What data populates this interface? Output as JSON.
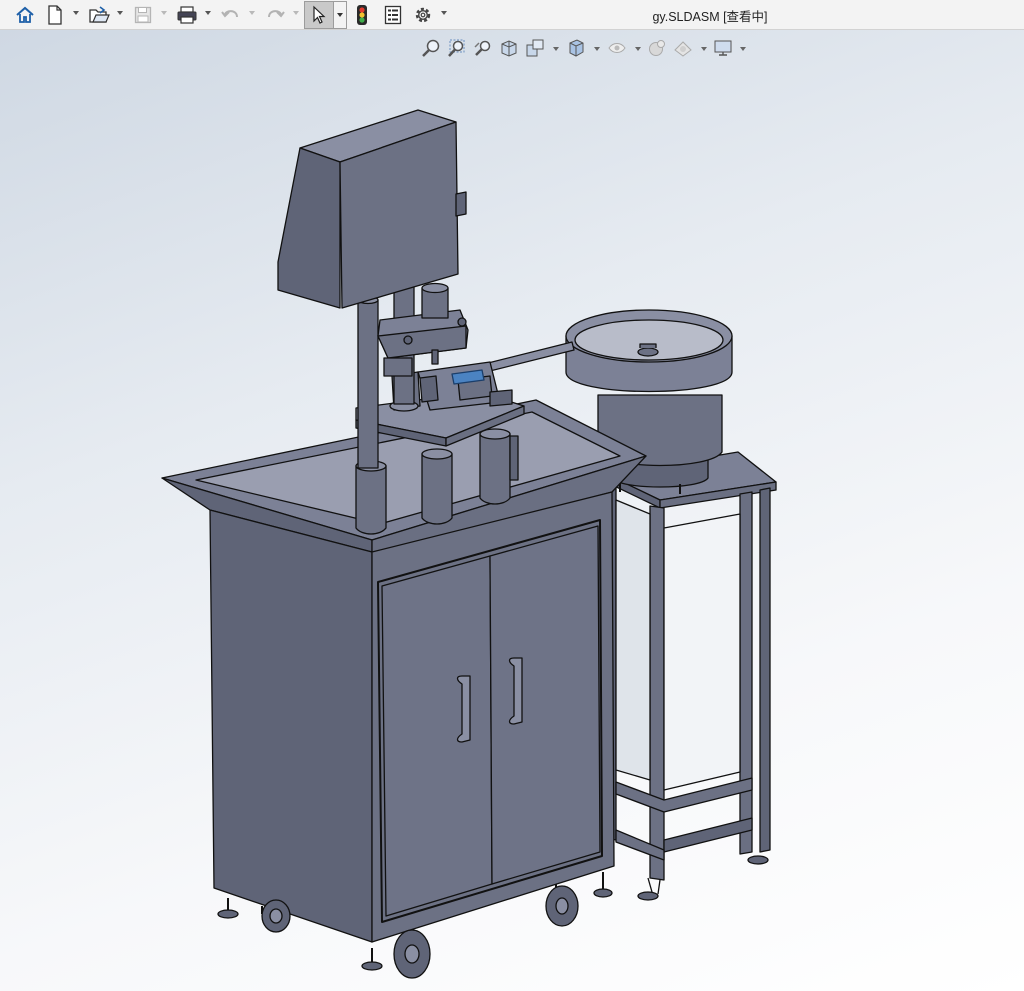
{
  "window": {
    "title": "gy.SLDASM [查看中]"
  },
  "toolbar": {
    "buttons": [
      {
        "name": "home",
        "icon": "home-icon"
      },
      {
        "name": "new",
        "icon": "new-document-icon"
      },
      {
        "name": "open",
        "icon": "open-folder-icon"
      },
      {
        "name": "save",
        "icon": "save-icon",
        "disabled": true
      },
      {
        "name": "print",
        "icon": "print-icon"
      },
      {
        "name": "undo",
        "icon": "undo-icon",
        "disabled": true
      },
      {
        "name": "redo",
        "icon": "redo-icon",
        "disabled": true
      },
      {
        "name": "select",
        "icon": "select-arrow-icon",
        "active": true
      },
      {
        "name": "rebuild",
        "icon": "traffic-light-icon"
      },
      {
        "name": "file-properties",
        "icon": "file-properties-icon"
      },
      {
        "name": "options",
        "icon": "gear-icon"
      }
    ]
  },
  "heads_up_toolbar": {
    "buttons": [
      {
        "name": "zoom-to-fit",
        "icon": "zoom-to-fit-icon"
      },
      {
        "name": "zoom-to-area",
        "icon": "zoom-to-area-icon"
      },
      {
        "name": "previous-view",
        "icon": "previous-view-icon"
      },
      {
        "name": "section-view",
        "icon": "section-view-icon"
      },
      {
        "name": "dynamic-annotation-views",
        "icon": "annotation-view-icon"
      },
      {
        "name": "view-orientation",
        "icon": "view-cube-icon"
      },
      {
        "name": "display-style",
        "icon": "display-style-icon"
      },
      {
        "name": "hide-show-items",
        "icon": "eye-icon"
      },
      {
        "name": "edit-appearance",
        "icon": "appearance-sphere-icon"
      },
      {
        "name": "apply-scene",
        "icon": "scene-icon"
      },
      {
        "name": "view-settings",
        "icon": "monitor-icon"
      }
    ]
  },
  "colors": {
    "body_fill": "#6c7184",
    "body_dark": "#5f6477",
    "body_light": "#7c8196",
    "edge": "#111111",
    "toolbar_icon": "#1d5fa8"
  }
}
